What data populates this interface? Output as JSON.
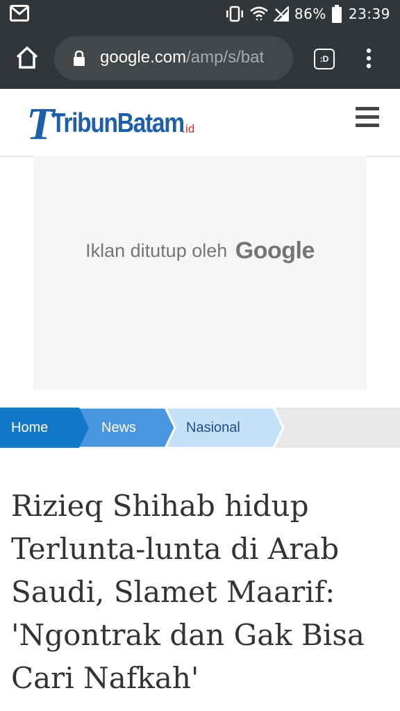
{
  "status_bar": {
    "battery": "86%",
    "time": "23:39",
    "icons": [
      "gmail-icon",
      "vibrate-icon",
      "wifi-icon",
      "signal-icon",
      "battery-icon"
    ]
  },
  "browser": {
    "url_host": "google.com",
    "url_path": "/amp/s/bat",
    "tabs_label": ":D",
    "icons": [
      "home-icon",
      "lock-icon",
      "tab-switcher-icon",
      "overflow-menu-icon"
    ]
  },
  "site": {
    "logo_text": "TribunBatam",
    "logo_tld": ".id",
    "brand_blue": "#1d5fa8",
    "brand_red": "#e0312a"
  },
  "ad": {
    "closed_message": "Iklan ditutup oleh",
    "closed_brand": "Google"
  },
  "breadcrumb": {
    "items": [
      {
        "label": "Home",
        "bg": "#1378c7",
        "color": "#ffffff"
      },
      {
        "label": "News",
        "bg": "#4a95e0",
        "color": "#ffffff"
      },
      {
        "label": "Nasional",
        "bg": "#c6e0fa",
        "color": "#1e4f8a"
      }
    ]
  },
  "article": {
    "title": "Rizieq Shihab hidup Terlunta-lunta di Arab Saudi, Slamet Maarif: 'Ngontrak dan Gak Bisa Cari Nafkah'"
  }
}
